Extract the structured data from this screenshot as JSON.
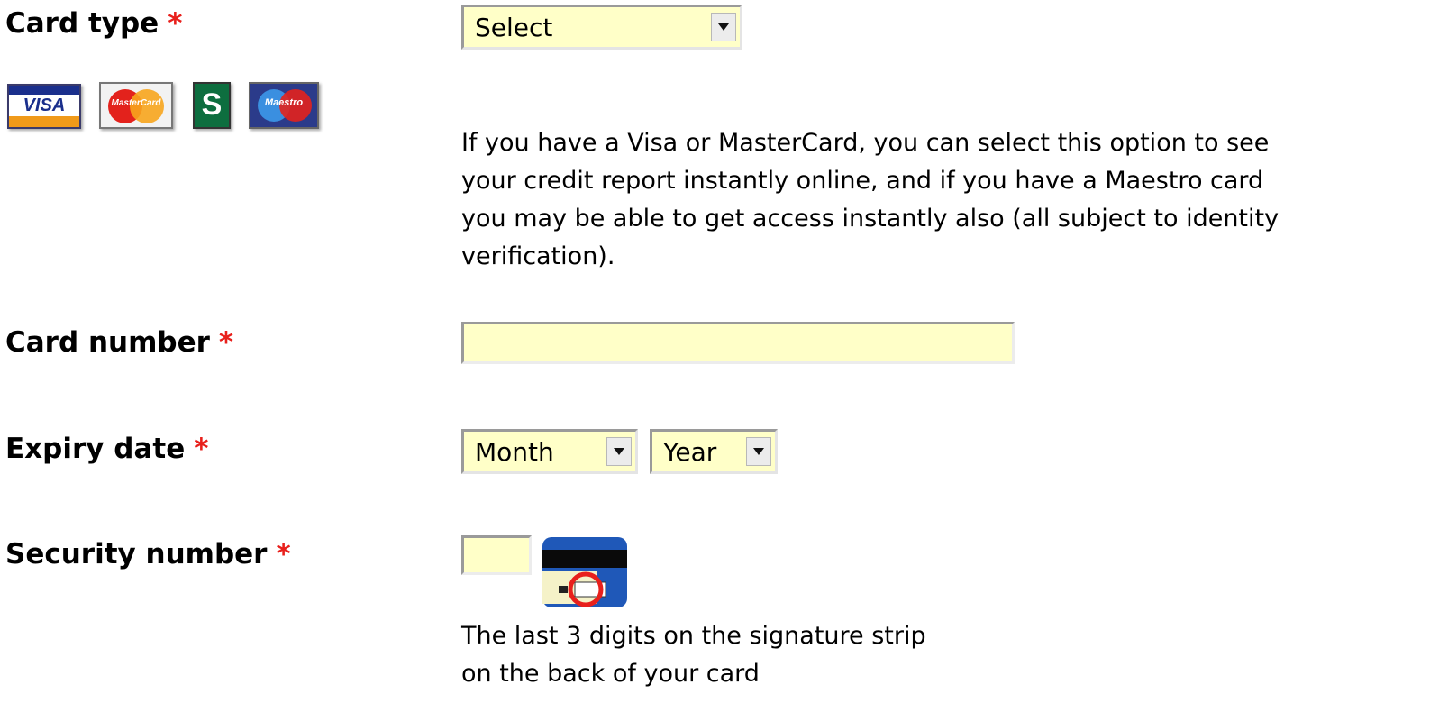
{
  "card_type": {
    "label": "Card type",
    "required_mark": "*",
    "select_value": "Select",
    "logos": [
      {
        "name": "visa-logo",
        "text": "VISA"
      },
      {
        "name": "mastercard-logo",
        "text": "MasterCard"
      },
      {
        "name": "switch-logo",
        "text": "S"
      },
      {
        "name": "maestro-logo",
        "text": "Maestro"
      }
    ],
    "info_lines": [
      "If you have a Visa or MasterCard, you can select this option to see",
      "your credit report instantly online, and if you have a Maestro card",
      "you may be able to get access instantly also (all subject to identity",
      "verification)."
    ]
  },
  "card_number": {
    "label": "Card number",
    "required_mark": "*",
    "value": ""
  },
  "expiry_date": {
    "label": "Expiry date",
    "required_mark": "*",
    "month_value": "Month",
    "year_value": "Year"
  },
  "security_number": {
    "label": "Security number",
    "required_mark": "*",
    "value": "",
    "hint_lines": [
      "The last 3 digits on the signature strip",
      "on the back of your card"
    ]
  },
  "colors": {
    "field_background": "#ffffc8",
    "required_color": "#e8201c"
  }
}
